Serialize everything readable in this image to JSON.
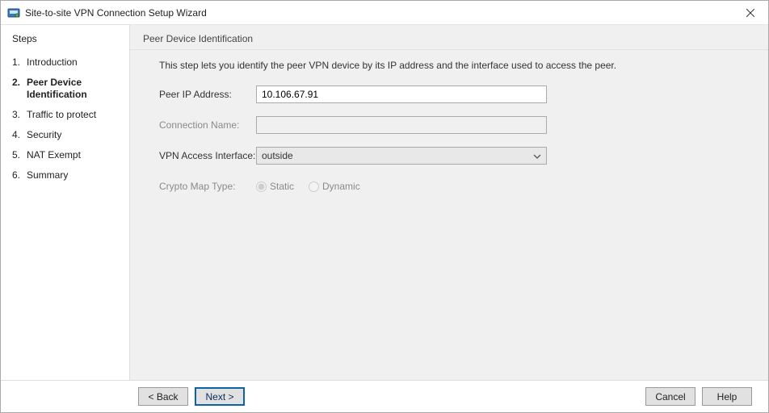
{
  "title": "Site-to-site VPN Connection Setup Wizard",
  "sidebar": {
    "heading": "Steps",
    "items": [
      {
        "num": "1.",
        "label": "Introduction"
      },
      {
        "num": "2.",
        "label": "Peer Device Identification"
      },
      {
        "num": "3.",
        "label": "Traffic to protect"
      },
      {
        "num": "4.",
        "label": "Security"
      },
      {
        "num": "5.",
        "label": "NAT Exempt"
      },
      {
        "num": "6.",
        "label": "Summary"
      }
    ],
    "current_index": 1
  },
  "content": {
    "heading": "Peer Device Identification",
    "description": "This step lets you identify the peer VPN device by its IP address and the interface used to access the peer.",
    "fields": {
      "peer_ip": {
        "label": "Peer IP Address:",
        "value": "10.106.67.91"
      },
      "conn_name": {
        "label": "Connection Name:",
        "value": ""
      },
      "vpn_interface": {
        "label": "VPN Access Interface:",
        "value": "outside"
      },
      "crypto_map": {
        "label": "Crypto Map Type:",
        "options": {
          "static": "Static",
          "dynamic": "Dynamic"
        },
        "selected": "static",
        "enabled": false
      }
    }
  },
  "buttons": {
    "back": "< Back",
    "next": "Next >",
    "cancel": "Cancel",
    "help": "Help"
  }
}
